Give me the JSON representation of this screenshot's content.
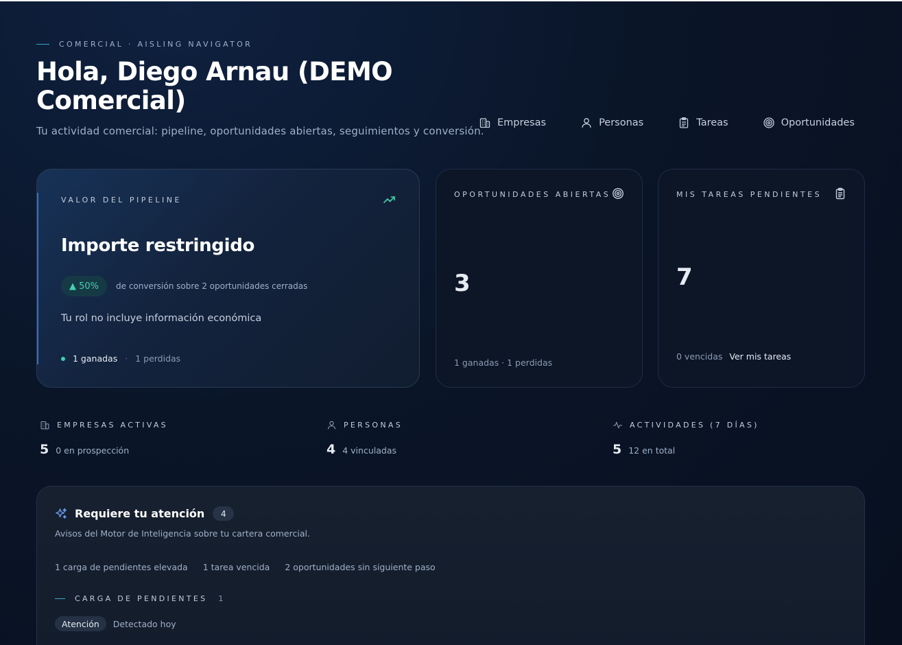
{
  "header": {
    "eyebrow": "COMERCIAL · AISLING NAVIGATOR",
    "title": "Hola, Diego Arnau (DEMO Comercial)",
    "subtitle": "Tu actividad comercial: pipeline, oportunidades abiertas, seguimientos y conversión."
  },
  "nav": [
    {
      "label": "Empresas",
      "icon": "building-icon"
    },
    {
      "label": "Personas",
      "icon": "user-icon"
    },
    {
      "label": "Tareas",
      "icon": "clipboard-icon"
    },
    {
      "label": "Oportunidades",
      "icon": "target-icon"
    }
  ],
  "pipeline": {
    "label": "VALOR DEL PIPELINE",
    "amount": "Importe restringido",
    "badge": "▲ 50%",
    "badge_note": "de conversión sobre 2 oportunidades cerradas",
    "note": "Tu rol no incluye información económica",
    "won": "1 ganadas",
    "separator": "·",
    "lost": "1 perdidas"
  },
  "opportunities": {
    "label": "OPORTUNIDADES ABIERTAS",
    "value": "3",
    "footer": "1 ganadas · 1 perdidas"
  },
  "tasks": {
    "label": "MIS TAREAS PENDIENTES",
    "value": "7",
    "overdue": "0 vencidas",
    "link": "Ver mis tareas"
  },
  "stats": [
    {
      "label": "EMPRESAS ACTIVAS",
      "value": "5",
      "sub": "0 en prospección",
      "icon": "building-icon"
    },
    {
      "label": "PERSONAS",
      "value": "4",
      "sub": "4 vinculadas",
      "icon": "user-icon"
    },
    {
      "label": "ACTIVIDADES (7 DÍAS)",
      "value": "5",
      "sub": "12 en total",
      "icon": "activity-icon"
    }
  ],
  "attention": {
    "title": "Requiere tu atención",
    "count": "4",
    "description": "Avisos del Motor de Inteligencia sobre tu cartera comercial.",
    "chips": [
      "1 carga de pendientes elevada",
      "1 tarea vencida",
      "2 oportunidades sin siguiente paso"
    ],
    "section_label": "CARGA DE PENDIENTES",
    "section_count": "1",
    "pill": "Atención",
    "detected": "Detectado hoy"
  },
  "colors": {
    "accent_teal": "#42d3b0",
    "accent_blue": "#2f6fd0",
    "background": "#0a1528"
  }
}
